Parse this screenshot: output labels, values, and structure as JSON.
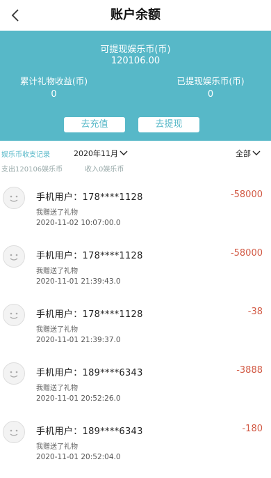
{
  "header": {
    "title": "账户余额"
  },
  "balance": {
    "withdrawable_label": "可提现娱乐币(币)",
    "withdrawable_value": "120106.00",
    "gift_income_label": "累计礼物收益(币)",
    "gift_income_value": "0",
    "withdrawn_label": "已提现娱乐币(币)",
    "withdrawn_value": "0",
    "recharge_label": "去充值",
    "withdraw_label": "去提现"
  },
  "filters": {
    "records_label": "娱乐币收支记录",
    "month": "2020年11月",
    "type": "全部",
    "expense_summary": "支出120106娱乐币",
    "income_summary": "收入0娱乐币"
  },
  "transactions": [
    {
      "name": "手机用户：178****1128",
      "desc": "我赠送了礼物",
      "time": "2020-11-02 10:07:00.0",
      "amount": "-58000"
    },
    {
      "name": "手机用户：178****1128",
      "desc": "我赠送了礼物",
      "time": "2020-11-01 21:39:43.0",
      "amount": "-58000"
    },
    {
      "name": "手机用户：178****1128",
      "desc": "我赠送了礼物",
      "time": "2020-11-01 21:39:37.0",
      "amount": "-38"
    },
    {
      "name": "手机用户：189****6343",
      "desc": "我赠送了礼物",
      "time": "2020-11-01 20:52:26.0",
      "amount": "-3888"
    },
    {
      "name": "手机用户：189****6343",
      "desc": "我赠送了礼物",
      "time": "2020-11-01 20:52:04.0",
      "amount": "-180"
    }
  ],
  "colors": {
    "accent": "#57b8c8",
    "negative": "#d25a45"
  },
  "icons": {
    "back": "chevron-left-icon",
    "dropdown": "chevron-down-icon",
    "avatar": "user-avatar"
  }
}
